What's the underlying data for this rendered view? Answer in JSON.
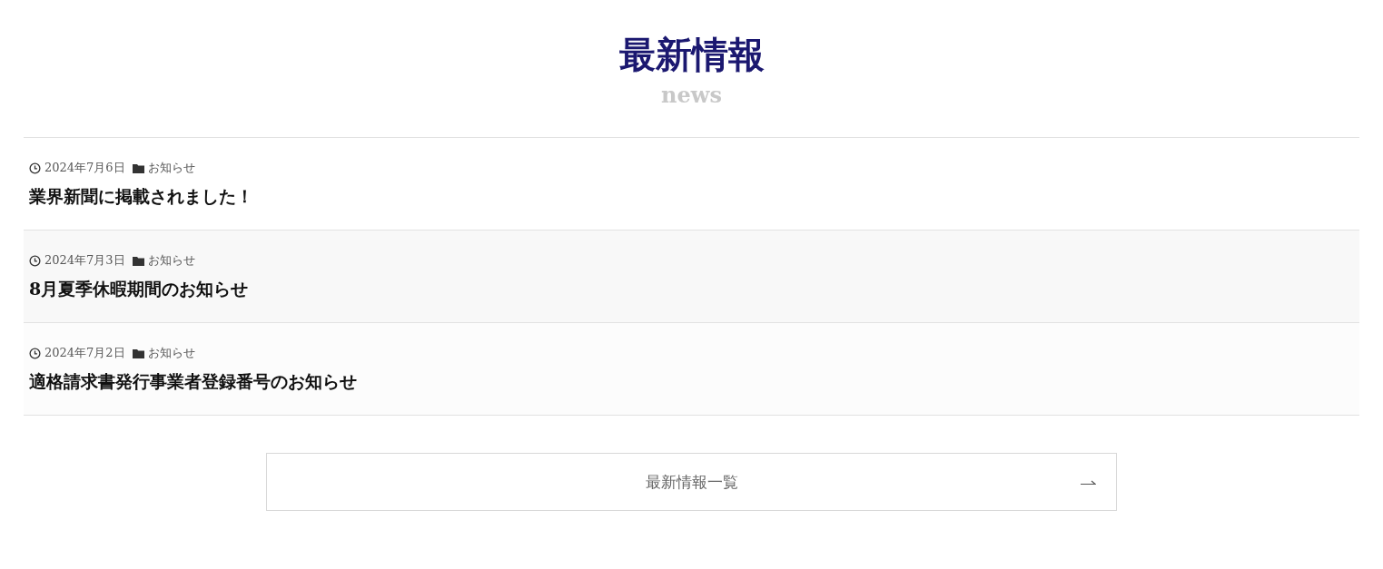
{
  "heading": {
    "title": "最新情報",
    "subtitle": "news"
  },
  "posts": [
    {
      "date": "2024年7月6日",
      "category": "お知らせ",
      "title": "業界新聞に掲載されました！"
    },
    {
      "date": "2024年7月3日",
      "category": "お知らせ",
      "title": "8月夏季休暇期間のお知らせ"
    },
    {
      "date": "2024年7月2日",
      "category": "お知らせ",
      "title": "適格請求書発行事業者登録番号のお知らせ"
    }
  ],
  "more_button": {
    "label": "最新情報一覧"
  }
}
